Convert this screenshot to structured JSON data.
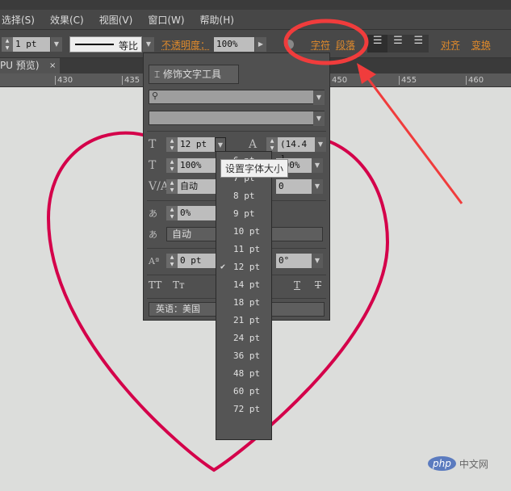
{
  "menu": [
    "选择(S)",
    "效果(C)",
    "视图(V)",
    "窗口(W)",
    "帮助(H)"
  ],
  "toolbar": {
    "stroke_weight": "1 pt",
    "stroke_profile": "等比",
    "opacity_label": "不透明度：",
    "opacity": "100%",
    "character": "字符",
    "paragraph": "段落",
    "align": "对齐",
    "transform": "变换"
  },
  "tab": {
    "label": "PU 预览)",
    "close": "×"
  },
  "ruler": [
    "430",
    "435",
    "450",
    "455",
    "460"
  ],
  "panel": {
    "touch_type": "修饰文字工具",
    "font_size": "12 pt",
    "leading": "(14.4 ]",
    "vscale": "100%",
    "hscale": "100%",
    "kerning": "自动",
    "tracking": "0",
    "tsume": "0%",
    "aki": "自动",
    "baseline": "0 pt",
    "rotation": "0°",
    "language": "英语：美国"
  },
  "tooltip": "设置字体大小",
  "sizes": [
    "6 pt",
    "7 pt",
    "8 pt",
    "9 pt",
    "10 pt",
    "11 pt",
    "12 pt",
    "14 pt",
    "18 pt",
    "21 pt",
    "24 pt",
    "36 pt",
    "48 pt",
    "60 pt",
    "72 pt"
  ],
  "selected_size": "12 pt",
  "watermark": "php 中文网",
  "colors": {
    "heart": "#d4004a",
    "annotation": "#f03c3c"
  }
}
